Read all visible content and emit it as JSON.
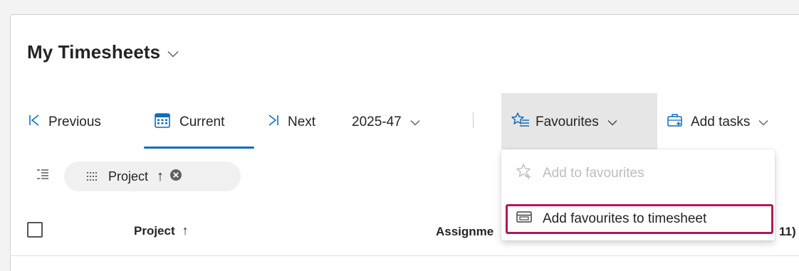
{
  "page": {
    "title": "My Timesheets"
  },
  "toolbar": {
    "previous_label": "Previous",
    "current_label": "Current",
    "next_label": "Next",
    "period_label": "2025-47",
    "favourites_label": "Favourites",
    "add_tasks_label": "Add tasks"
  },
  "grouping": {
    "chip_label": "Project",
    "sort_symbol": "↑"
  },
  "table": {
    "columns": {
      "project": "Project",
      "project_sort_symbol": "↑",
      "assignment": "Assignme",
      "right": "11)"
    }
  },
  "favourites_menu": {
    "items": [
      {
        "label": "Add to favourites",
        "disabled": true,
        "icon": "star-add-icon"
      },
      {
        "label": "Add favourites to timesheet",
        "disabled": false,
        "icon": "window-add-icon",
        "highlighted": true
      }
    ]
  },
  "colors": {
    "accent": "#0f6cbd",
    "highlight_border": "#b0195a",
    "disabled_text": "#bdbdbd"
  }
}
